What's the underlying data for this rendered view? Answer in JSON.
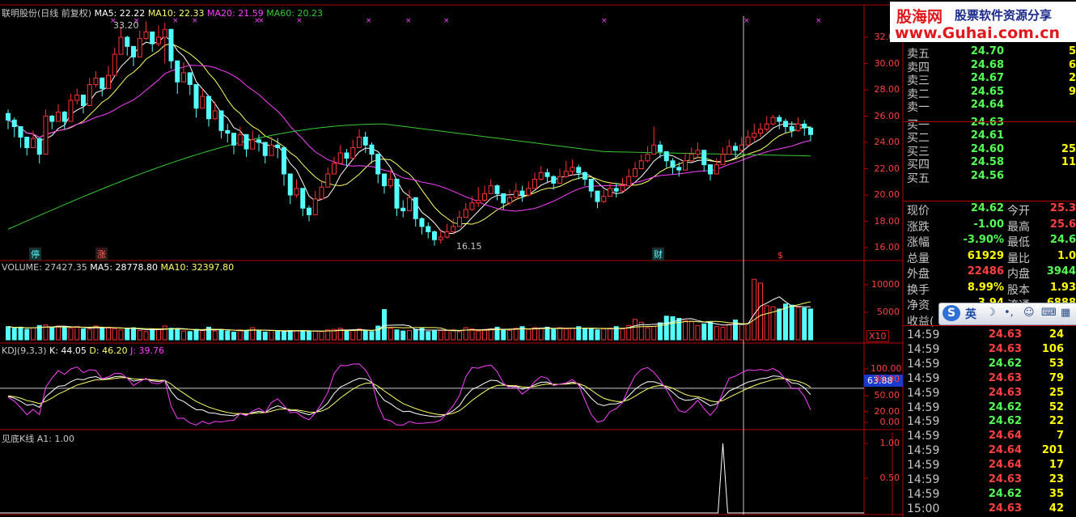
{
  "colors": {
    "up": "#ff3232",
    "down": "#54ffff",
    "ma5": "#ffffff",
    "ma10": "#ffff66",
    "ma20": "#ff40ff",
    "ma60": "#33cc33",
    "grid": "#b40000",
    "text": "#c8c8c8"
  },
  "header": {
    "stock": "联明股份(日线 前复权)",
    "ma5": "MA5: 22.22",
    "ma10": "MA10: 22.33",
    "ma20": "MA20: 21.59",
    "ma60": "MA60: 20.23",
    "volume": "VOLUME: 27427.35",
    "vma5": "MA5: 28778.80",
    "vma10": "MA10: 32397.80",
    "kdj": "KDJ(9,3,3)",
    "k": "K: 44.05",
    "d": "D: 46.20",
    "j": "J: 39.76",
    "ind": "见底K线",
    "a1": "A1: 1.00"
  },
  "annotations": {
    "high": "33.20",
    "low": "16.15",
    "ting": "停",
    "zhang": "涨",
    "cai": "财",
    "dollar": "$",
    "x10": "X10",
    "kdjbox": "63.88"
  },
  "watermark": {
    "site": "股海网",
    "slogan": "股票软件资源分享",
    "url": "www.Guhai.com.cn"
  },
  "ime": {
    "s": "S",
    "en": "英"
  },
  "chart_data": [
    {
      "type": "candlestick",
      "title": "联明股份(日线 前复权)",
      "ylim": [
        15.2,
        33.8
      ],
      "yticks": [
        "32.00",
        "30.00",
        "28.00",
        "26.00",
        "24.00",
        "22.00",
        "20.00",
        "18.00",
        "16.00"
      ],
      "close": [
        25.7,
        25.2,
        24.4,
        23.6,
        24.3,
        23.1,
        26.0,
        25.6,
        26.3,
        25.6,
        27.2,
        27.6,
        26.8,
        28.4,
        28.9,
        28.1,
        29.1,
        30.7,
        32.0,
        31.3,
        30.5,
        31.9,
        32.4,
        31.5,
        32.0,
        32.6,
        30.2,
        28.6,
        29.3,
        28.4,
        26.6,
        27.5,
        25.8,
        26.4,
        24.9,
        24.7,
        23.8,
        24.6,
        23.5,
        24.2,
        24.0,
        23.0,
        23.8,
        23.6,
        21.6,
        20.0,
        20.5,
        19.0,
        18.5,
        19.7,
        20.6,
        21.6,
        22.4,
        23.2,
        22.8,
        23.6,
        24.4,
        23.8,
        23.1,
        21.6,
        20.7,
        21.2,
        19.0,
        18.8,
        19.8,
        18.2,
        17.6,
        17.2,
        16.6,
        16.8,
        17.2,
        17.6,
        18.3,
        18.9,
        19.4,
        19.6,
        20.1,
        20.7,
        20.1,
        19.4,
        19.8,
        20.3,
        20.0,
        20.5,
        21.2,
        21.7,
        21.4,
        20.9,
        21.4,
        21.8,
        22.1,
        21.7,
        21.2,
        20.3,
        19.5,
        19.9,
        20.5,
        20.3,
        20.7,
        21.4,
        22.0,
        22.6,
        23.1,
        23.8,
        23.3,
        22.6,
        22.1,
        21.9,
        22.6,
        23.1,
        23.4,
        22.3,
        21.6,
        22.3,
        23.1,
        23.7,
        23.4,
        23.8,
        24.4,
        24.7,
        25.0,
        25.4,
        25.9,
        25.6,
        25.2,
        24.9,
        25.4,
        25.1,
        24.6
      ],
      "high": [
        26.5,
        25.9,
        25.2,
        24.4,
        24.9,
        24.2,
        26.5,
        26.1,
        26.9,
        26.4,
        27.7,
        28.1,
        27.5,
        28.9,
        29.4,
        28.9,
        29.8,
        31.2,
        32.8,
        32.1,
        31.3,
        32.5,
        33.2,
        32.3,
        32.9,
        33.1,
        31.0,
        29.9,
        30.1,
        29.2,
        27.6,
        28.1,
        26.8,
        27.1,
        25.7,
        25.4,
        24.6,
        25.2,
        24.2,
        24.9,
        24.6,
        23.8,
        24.4,
        24.3,
        22.5,
        20.8,
        21.2,
        19.8,
        19.2,
        20.3,
        21.1,
        22.1,
        22.9,
        23.8,
        23.5,
        24.2,
        25.0,
        24.8,
        24.0,
        22.6,
        21.5,
        21.9,
        19.8,
        19.6,
        20.4,
        19.0,
        18.3,
        17.9,
        17.3,
        17.4,
        17.8,
        18.2,
        18.8,
        19.4,
        19.9,
        20.6,
        20.7,
        21.2,
        20.8,
        20.1,
        20.4,
        20.9,
        20.7,
        21.0,
        21.7,
        22.2,
        22.0,
        21.5,
        22.0,
        22.6,
        22.7,
        22.3,
        21.8,
        21.1,
        20.1,
        20.4,
        21.0,
        20.9,
        21.3,
        22.0,
        22.5,
        23.1,
        23.7,
        25.2,
        24.1,
        23.3,
        22.8,
        22.5,
        23.2,
        23.6,
        24.0,
        23.1,
        22.3,
        22.8,
        23.6,
        24.2,
        24.0,
        24.4,
        24.9,
        25.4,
        25.5,
        26.0,
        26.1,
        26.1,
        25.8,
        25.6,
        25.9,
        25.7,
        25.2
      ],
      "low": [
        25.0,
        24.4,
        23.6,
        23.0,
        23.6,
        22.4,
        25.2,
        25.0,
        25.6,
        25.0,
        26.6,
        26.9,
        26.2,
        27.9,
        28.2,
        27.5,
        28.5,
        30.0,
        31.4,
        30.6,
        29.8,
        31.2,
        31.8,
        30.9,
        31.3,
        30.0,
        29.6,
        27.7,
        28.6,
        27.6,
        25.9,
        26.9,
        25.2,
        25.7,
        24.3,
        24.0,
        23.1,
        23.9,
        22.9,
        23.5,
        23.3,
        22.4,
        23.1,
        22.8,
        20.7,
        19.3,
        19.8,
        18.4,
        18.0,
        19.1,
        20.0,
        20.9,
        21.8,
        22.6,
        22.2,
        22.9,
        23.7,
        23.2,
        22.4,
        20.9,
        20.1,
        20.5,
        18.4,
        18.3,
        19.2,
        17.6,
        17.0,
        16.7,
        16.15,
        16.3,
        16.7,
        17.0,
        17.7,
        18.3,
        18.8,
        19.1,
        19.5,
        20.1,
        19.6,
        18.9,
        19.2,
        19.8,
        19.5,
        19.9,
        20.6,
        21.1,
        20.9,
        20.4,
        20.9,
        21.3,
        21.5,
        21.2,
        20.7,
        19.8,
        19.0,
        19.4,
        19.9,
        19.8,
        20.2,
        20.8,
        21.4,
        22.0,
        22.5,
        23.1,
        22.8,
        22.1,
        21.6,
        21.4,
        22.0,
        22.5,
        22.8,
        21.8,
        21.1,
        21.7,
        22.5,
        23.1,
        22.9,
        23.2,
        23.8,
        24.1,
        24.4,
        24.8,
        25.3,
        25.0,
        24.7,
        24.4,
        24.8,
        24.5,
        24.1
      ],
      "ma_names": [
        "MA5",
        "MA10",
        "MA20",
        "MA60"
      ]
    },
    {
      "type": "bar",
      "title": "VOLUME",
      "ylim": [
        0,
        11500
      ],
      "yticks": [
        "10000",
        "5000"
      ],
      "values": [
        2400,
        2100,
        2300,
        1900,
        2200,
        2600,
        2700,
        2300,
        2500,
        2300,
        2100,
        2400,
        2000,
        1900,
        2500,
        2200,
        2300,
        2000,
        1800,
        2100,
        2200,
        1700,
        1500,
        1900,
        2000,
        2500,
        2100,
        1900,
        1600,
        1500,
        1900,
        1700,
        2300,
        1600,
        1900,
        1600,
        1400,
        1800,
        1700,
        2200,
        1600,
        1400,
        1700,
        1600,
        1500,
        1700,
        1600,
        1700,
        1500,
        1600,
        1500,
        1800,
        1900,
        2100,
        1600,
        1700,
        2000,
        1600,
        1500,
        2500,
        5500,
        2100,
        1800,
        1600,
        1700,
        1900,
        2100,
        1500,
        1600,
        1700,
        1700,
        1800,
        1500,
        2200,
        2000,
        1600,
        1900,
        2000,
        2300,
        1800,
        1700,
        2100,
        2400,
        1900,
        2200,
        2100,
        2300,
        1900,
        2200,
        2000,
        2100,
        2400,
        2000,
        2100,
        1800,
        2000,
        2100,
        2400,
        2000,
        2600,
        3700,
        3200,
        2200,
        2400,
        3100,
        4300,
        4200,
        3900,
        3500,
        3300,
        2600,
        2900,
        3200,
        2400,
        2300,
        2800,
        3600,
        2800,
        3000,
        11000,
        10300,
        6200,
        6000,
        5600,
        6500,
        6300,
        5900,
        5800,
        5600,
        6000
      ]
    },
    {
      "type": "line",
      "title": "KDJ(9,3,3)",
      "ylim": [
        0,
        110
      ],
      "yticks": [
        "100.00",
        "80.00",
        "50.00",
        "20.00",
        "0.00"
      ],
      "level": 63.88,
      "series": [
        {
          "name": "K"
        },
        {
          "name": "D"
        },
        {
          "name": "J"
        }
      ]
    },
    {
      "type": "line",
      "title": "见底K线",
      "ylim": [
        0,
        1.1
      ],
      "yticks": [
        "1.00",
        "0.50"
      ],
      "signal_index": 114,
      "series": [
        {
          "name": "A1"
        }
      ]
    }
  ],
  "panel": {
    "sell": [
      {
        "l": "卖五",
        "p": "24.70",
        "v": "5"
      },
      {
        "l": "卖四",
        "p": "24.68",
        "v": "6"
      },
      {
        "l": "卖三",
        "p": "24.67",
        "v": "2"
      },
      {
        "l": "卖二",
        "p": "24.65",
        "v": "9"
      },
      {
        "l": "卖一",
        "p": "24.64",
        "v": ""
      }
    ],
    "buy": [
      {
        "l": "买一",
        "p": "24.63",
        "v": ""
      },
      {
        "l": "买二",
        "p": "24.61",
        "v": ""
      },
      {
        "l": "买三",
        "p": "24.60",
        "v": "25"
      },
      {
        "l": "买四",
        "p": "24.58",
        "v": "11"
      },
      {
        "l": "买五",
        "p": "24.56",
        "v": ""
      }
    ],
    "info": [
      {
        "l1": "现价",
        "v1": "24.62",
        "c1": "#54ff54",
        "l2": "今开",
        "v2": "25.3",
        "c2": "#ff4040"
      },
      {
        "l1": "涨跌",
        "v1": "-1.00",
        "c1": "#54ff54",
        "l2": "最高",
        "v2": "25.6",
        "c2": "#ff4040"
      },
      {
        "l1": "涨幅",
        "v1": "-3.90%",
        "c1": "#54ff54",
        "l2": "最低",
        "v2": "24.6",
        "c2": "#54ff54"
      },
      {
        "l1": "总量",
        "v1": "61929",
        "c1": "#ffff00",
        "l2": "量比",
        "v2": "1.0",
        "c2": "#ffff00"
      },
      {
        "l1": "外盘",
        "v1": "22486",
        "c1": "#ff4040",
        "l2": "内盘",
        "v2": "3944",
        "c2": "#54ff54"
      },
      {
        "l1": "换手",
        "v1": "8.99%",
        "c1": "#ffff00",
        "l2": "股本",
        "v2": "1.93",
        "c2": "#ffff00"
      },
      {
        "l1": "净资",
        "v1": "3.94",
        "c1": "#ffff00",
        "l2": "流通",
        "v2": "6888",
        "c2": "#ffff00"
      },
      {
        "l1": "收益(",
        "v1": "",
        "c1": "#ffff00",
        "l2": "",
        "v2": "",
        "c2": "#ffff00"
      }
    ],
    "ticks": [
      {
        "t": "14:59",
        "p": "24.63",
        "v": "24"
      },
      {
        "t": "14:59",
        "p": "24.63",
        "v": "106"
      },
      {
        "t": "14:59",
        "p": "24.62",
        "v": "53"
      },
      {
        "t": "14:59",
        "p": "24.63",
        "v": "79"
      },
      {
        "t": "14:59",
        "p": "24.63",
        "v": "25"
      },
      {
        "t": "14:59",
        "p": "24.62",
        "v": "52"
      },
      {
        "t": "14:59",
        "p": "24.62",
        "v": "22"
      },
      {
        "t": "14:59",
        "p": "24.64",
        "v": "7"
      },
      {
        "t": "14:59",
        "p": "24.64",
        "v": "201"
      },
      {
        "t": "14:59",
        "p": "24.64",
        "v": "17"
      },
      {
        "t": "14:59",
        "p": "24.63",
        "v": "23"
      },
      {
        "t": "14:59",
        "p": "24.62",
        "v": "35"
      },
      {
        "t": "15:00",
        "p": "24.63",
        "v": "42"
      }
    ]
  }
}
